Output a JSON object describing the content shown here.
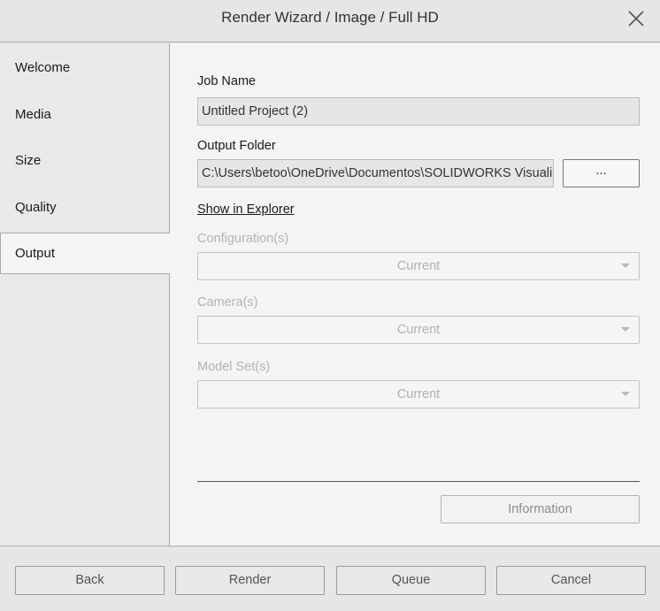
{
  "window": {
    "title": "Render Wizard / Image / Full HD",
    "close_icon": "close-icon"
  },
  "sidebar": {
    "items": [
      {
        "label": "Welcome",
        "active": false
      },
      {
        "label": "Media",
        "active": false
      },
      {
        "label": "Size",
        "active": false
      },
      {
        "label": "Quality",
        "active": false
      },
      {
        "label": "Output",
        "active": true
      }
    ]
  },
  "main": {
    "job_name_label": "Job Name",
    "job_name_value": "Untitled Project (2)",
    "output_folder_label": "Output Folder",
    "output_folder_value": "C:\\Users\\betoo\\OneDrive\\Documentos\\SOLIDWORKS Visualize Content",
    "browse_label": "...",
    "show_in_explorer": "Show in Explorer",
    "configurations_label": "Configuration(s)",
    "configurations_value": "Current",
    "cameras_label": "Camera(s)",
    "cameras_value": "Current",
    "model_sets_label": "Model Set(s)",
    "model_sets_value": "Current",
    "information_label": "Information"
  },
  "footer": {
    "back_label": "Back",
    "render_label": "Render",
    "queue_label": "Queue",
    "cancel_label": "Cancel"
  }
}
